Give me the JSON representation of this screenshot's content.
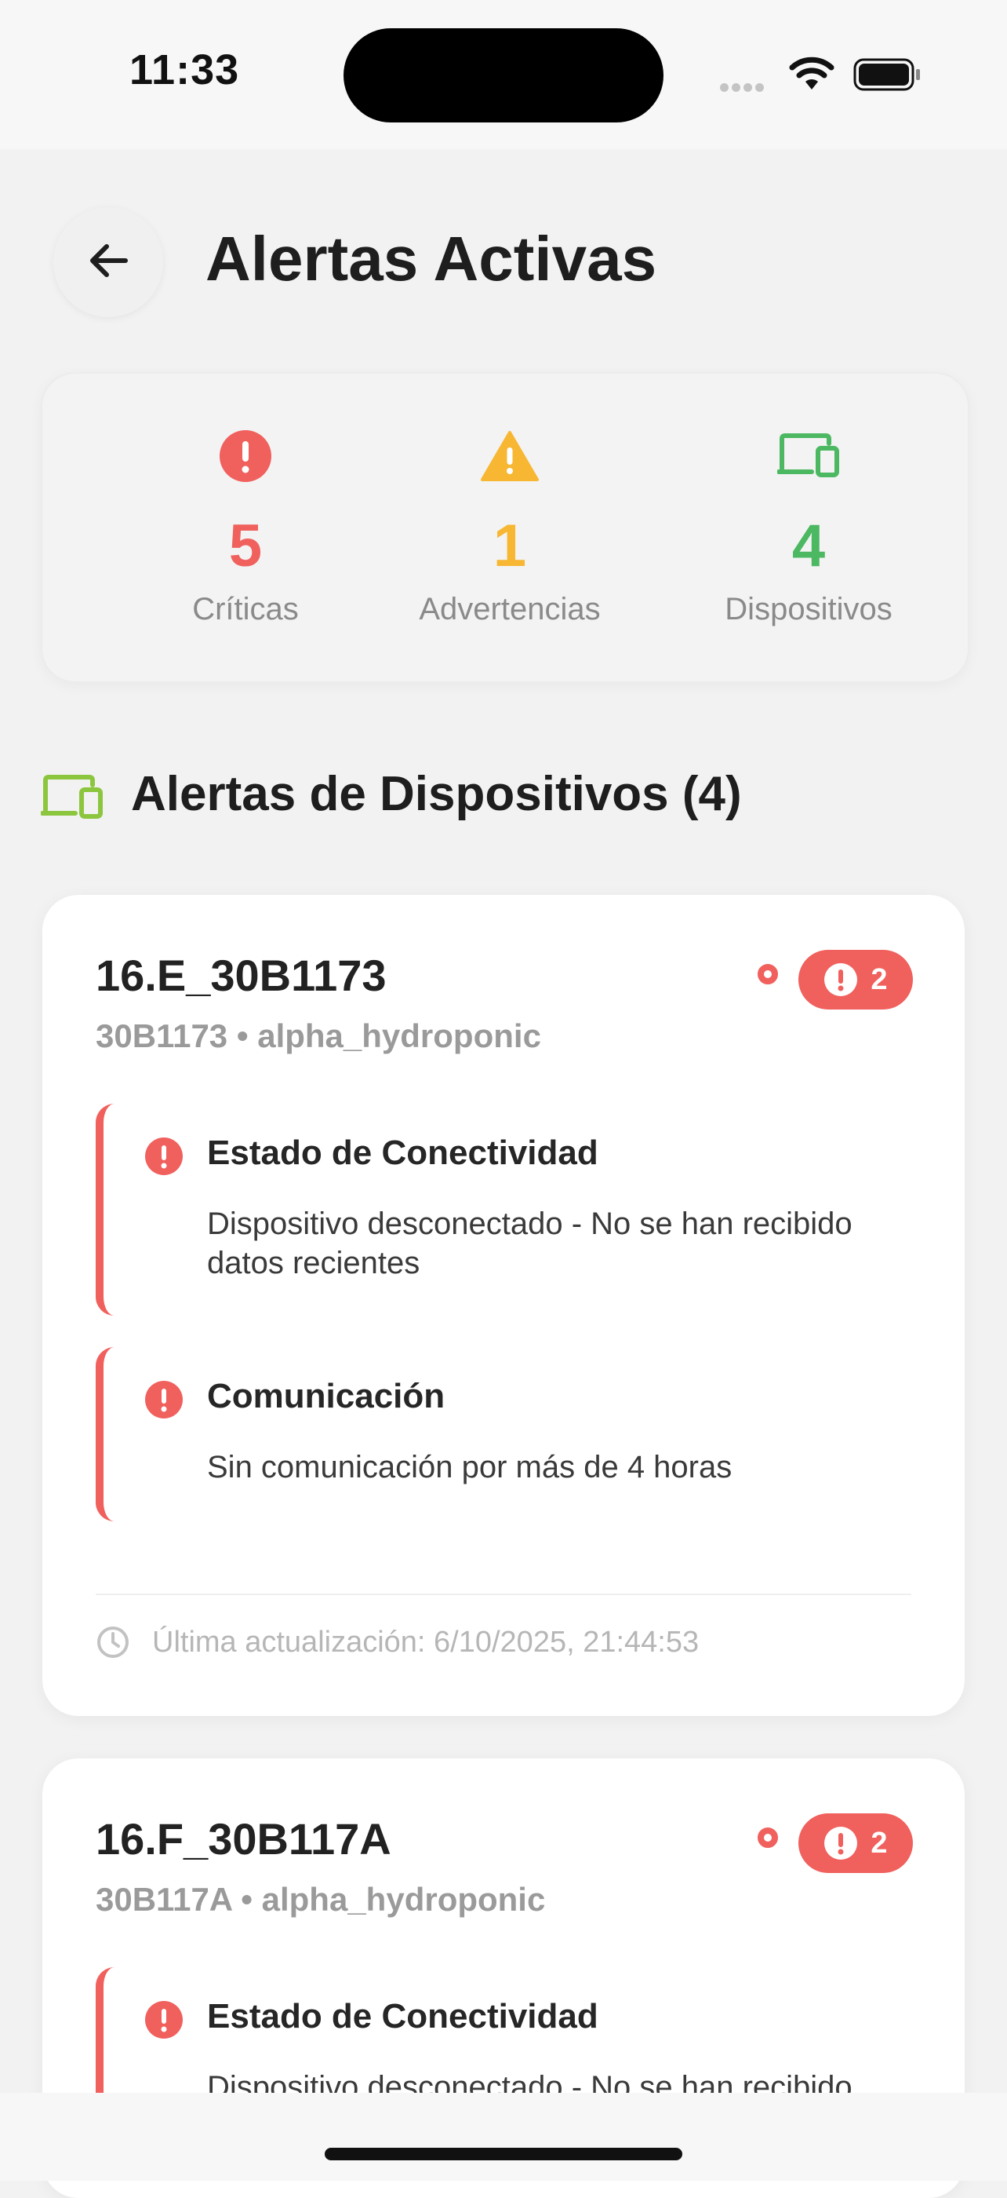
{
  "status_bar": {
    "time": "11:33"
  },
  "header": {
    "title": "Alertas Activas"
  },
  "summary": [
    {
      "value": "5",
      "label": "Críticas",
      "color": "#f0605d",
      "icon": "critical-icon"
    },
    {
      "value": "1",
      "label": "Advertencias",
      "color": "#f7b733",
      "icon": "warning-icon"
    },
    {
      "value": "4",
      "label": "Dispositivos",
      "color": "#4cb862",
      "icon": "devices-icon"
    }
  ],
  "section": {
    "title": "Alertas de Dispositivos (4)",
    "icon": "devices-icon",
    "icon_color": "#8cc63f"
  },
  "devices": [
    {
      "name": "16.E_30B1173",
      "subtitle": "30B1173 • alpha_hydroponic",
      "badge_count": "2",
      "alerts": [
        {
          "title": "Estado de Conectividad",
          "message": "Dispositivo desconectado - No se han recibido datos recientes"
        },
        {
          "title": "Comunicación",
          "message": "Sin comunicación por más de 4 horas"
        }
      ],
      "updated": "Última actualización: 6/10/2025, 21:44:53"
    },
    {
      "name": "16.F_30B117A",
      "subtitle": "30B117A • alpha_hydroponic",
      "badge_count": "2",
      "alerts": [
        {
          "title": "Estado de Conectividad",
          "message": "Dispositivo desconectado - No se han recibido datos recientes"
        }
      ]
    }
  ],
  "colors": {
    "critical": "#f0605d",
    "warning": "#f7b733",
    "ok": "#4cb862"
  }
}
